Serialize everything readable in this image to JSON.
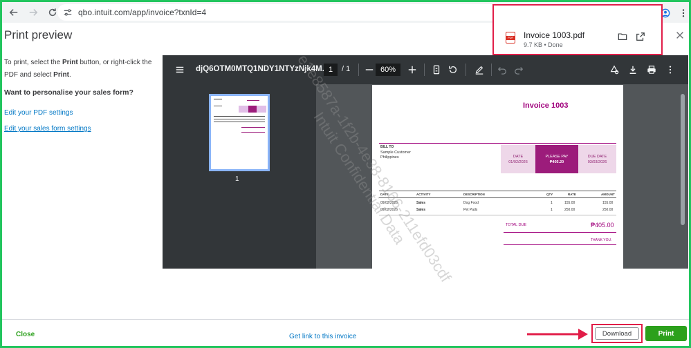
{
  "browser": {
    "url": "qbo.intuit.com/app/invoice?txnId=4",
    "icons": [
      "back-icon",
      "forward-icon",
      "reload-icon",
      "site-settings-icon",
      "zoom-icon",
      "bookmark-star-icon",
      "download-icon",
      "profile-icon",
      "menu-kebab-icon"
    ]
  },
  "download_popup": {
    "filename": "Invoice 1003.pdf",
    "meta": "9.7 KB • Done",
    "file_badge": "PDF"
  },
  "print_preview": {
    "title": "Print preview",
    "instructions_part1": "To print, select the ",
    "instructions_bold1": "Print",
    "instructions_part2": " button, or right-click the PDF and select ",
    "instructions_bold2": "Print",
    "instructions_end": ".",
    "personalise_heading": "Want to personalise your sales form?",
    "link_pdf_settings": "Edit your PDF settings",
    "link_sales_form": "Edit your sales form settings"
  },
  "pdf_viewer": {
    "doc_title": "djQ6OTM0MTQ1NDY1NTYzNjk4M...",
    "current_page": "1",
    "page_separator": "/ 1",
    "zoom": "60%",
    "thumbnail_page_number": "1"
  },
  "invoice": {
    "title": "Invoice  1003",
    "bill_to_label": "BILL TO",
    "customer_lines": [
      "Sample Customer",
      "Philippines"
    ],
    "date_label": "DATE",
    "date_value": "01/02/2026",
    "please_pay_label": "PLEASE PAY",
    "please_pay_value": "₱405.20",
    "due_date_label": "DUE DATE",
    "due_date_value": "03/03/2026",
    "columns": [
      "DATE",
      "ACTIVITY",
      "DESCRIPTION",
      "QTY",
      "RATE",
      "AMOUNT"
    ],
    "rows": [
      {
        "date": "09/02/2026",
        "activity": "Sales",
        "description": "Dog Food",
        "qty": "1",
        "rate": "155.00",
        "amount": "155.00"
      },
      {
        "date": "09/02/2026",
        "activity": "Sales",
        "description": "Pet Pads",
        "qty": "1",
        "rate": "250.00",
        "amount": "250.00"
      }
    ],
    "total_due_label": "TOTAL DUE",
    "total_due_value": "₱405.00",
    "thank_you": "THANK YOU."
  },
  "watermark": {
    "line1": "e1e8587a-1f2b-4e38-8166-211efd03cdf",
    "line2": "Intuit Confidential Data"
  },
  "footer": {
    "close_label": "Close",
    "get_link_label": "Get link to this invoice",
    "download_label": "Download",
    "print_label": "Print"
  },
  "colors": {
    "accent_green": "#2ca01c",
    "highlight_red": "#e11d48",
    "invoice_magenta": "#a0007c",
    "link_blue": "#0077c5",
    "frame_green": "#22c55e"
  }
}
